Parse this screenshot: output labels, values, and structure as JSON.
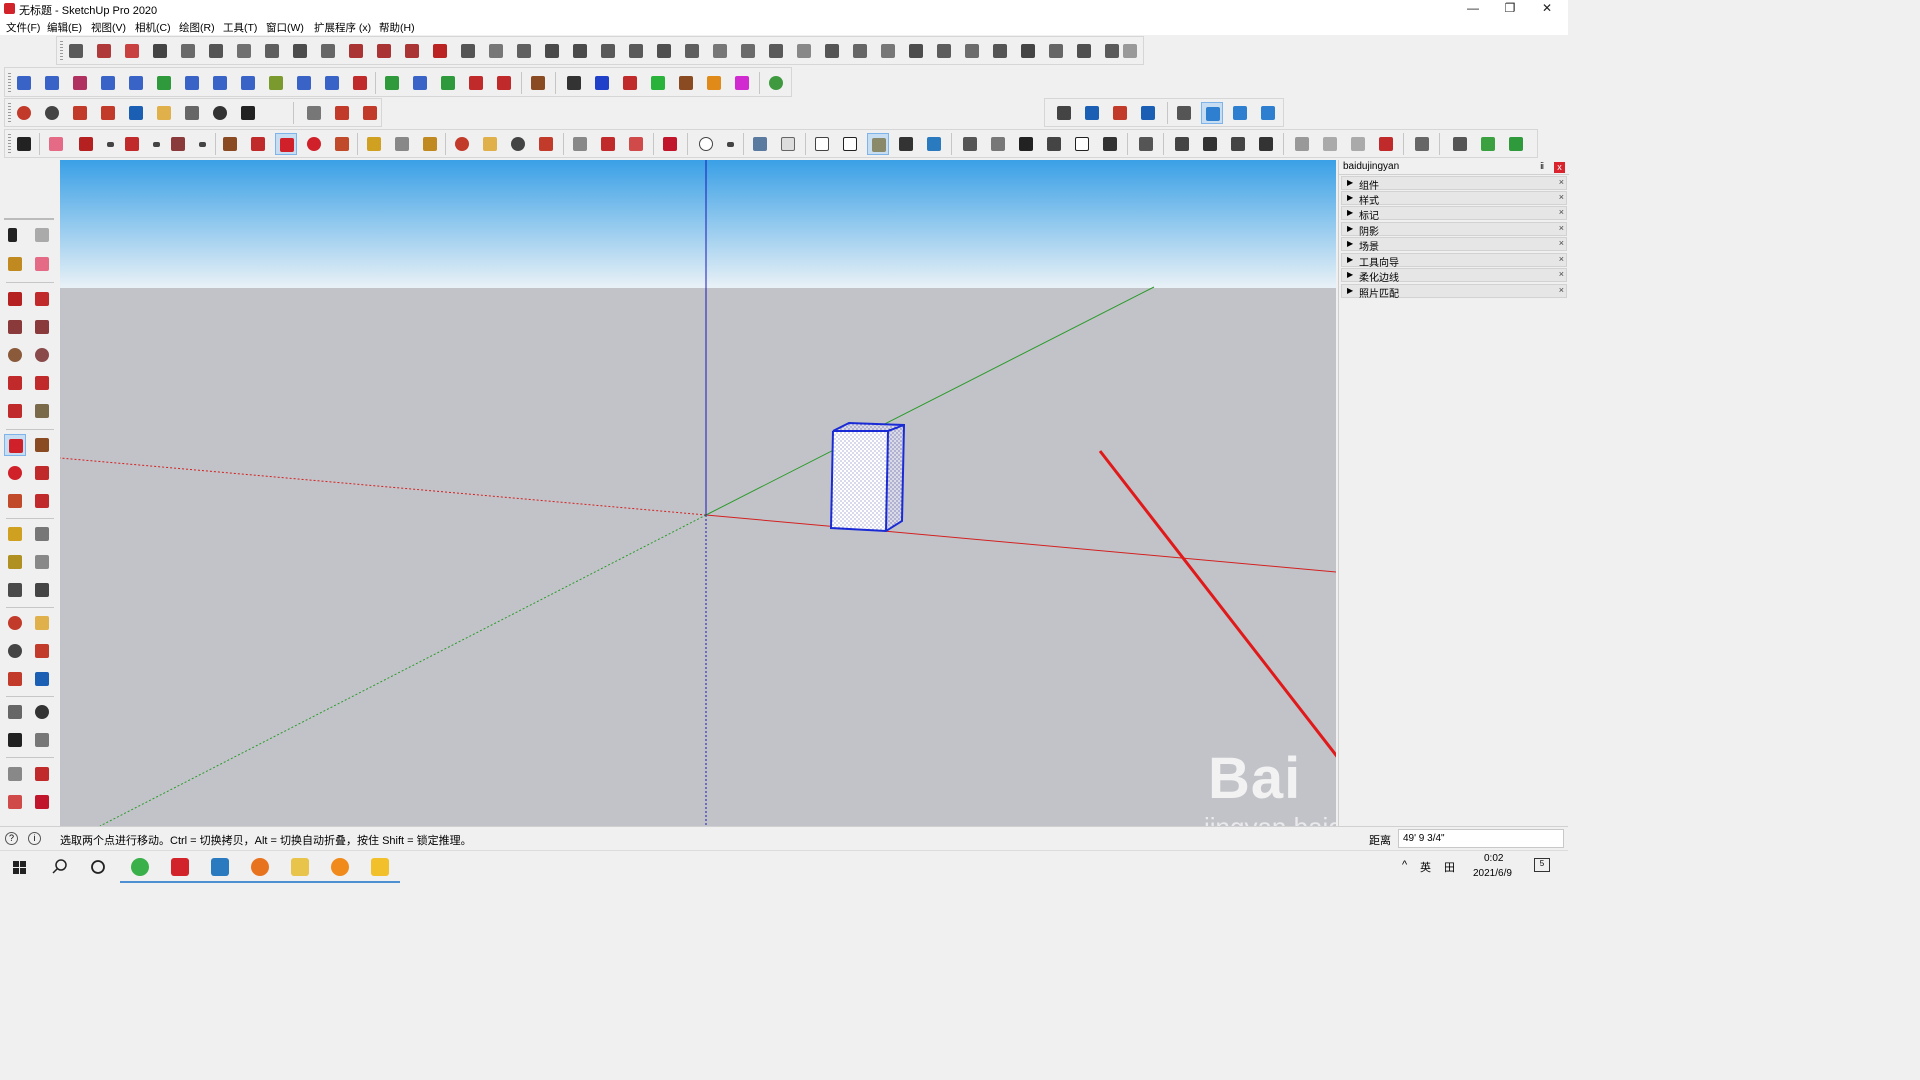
{
  "window": {
    "title": "无标题 - SketchUp Pro 2020",
    "controls": {
      "minimize": "—",
      "restore": "❐",
      "close": "✕"
    }
  },
  "menu": [
    "文件(F)",
    "编辑(E)",
    "视图(V)",
    "相机(C)",
    "绘图(R)",
    "工具(T)",
    "窗口(W)",
    "扩展程序 (x)",
    "帮助(H)"
  ],
  "tray": {
    "title": "baidujingyan",
    "pin": "ⅱ",
    "close": "x",
    "items": [
      "组件",
      "样式",
      "标记",
      "阴影",
      "场景",
      "工具向导",
      "柔化边线",
      "照片匹配"
    ]
  },
  "status": {
    "message": "选取两个点进行移动。Ctrl = 切换拷贝，Alt = 切换自动折叠，按住 Shift = 锁定推理。",
    "vcb_label": "距离",
    "vcb_value": "49' 9 3/4\"",
    "info_icon_1": "?",
    "info_icon_2": "i"
  },
  "watermark": {
    "brand": "Bai经验",
    "url": "jingyan.baidu.com"
  },
  "taskbar": {
    "tray_up": "^",
    "ime_lang": "英",
    "ime_mode": "田",
    "time": "0:02",
    "date": "2021/6/9",
    "notifications": "5"
  },
  "colors": {
    "sky_top": "#3aa0e6",
    "sky_bottom": "#e8f1f7",
    "ground": "#c2c3c8",
    "axis_red": "#d32020",
    "axis_green": "#2b9a2b",
    "axis_blue": "#1a1ab8",
    "selection_blue": "#1a2bd6",
    "annotation_arrow": "#e0191b"
  }
}
